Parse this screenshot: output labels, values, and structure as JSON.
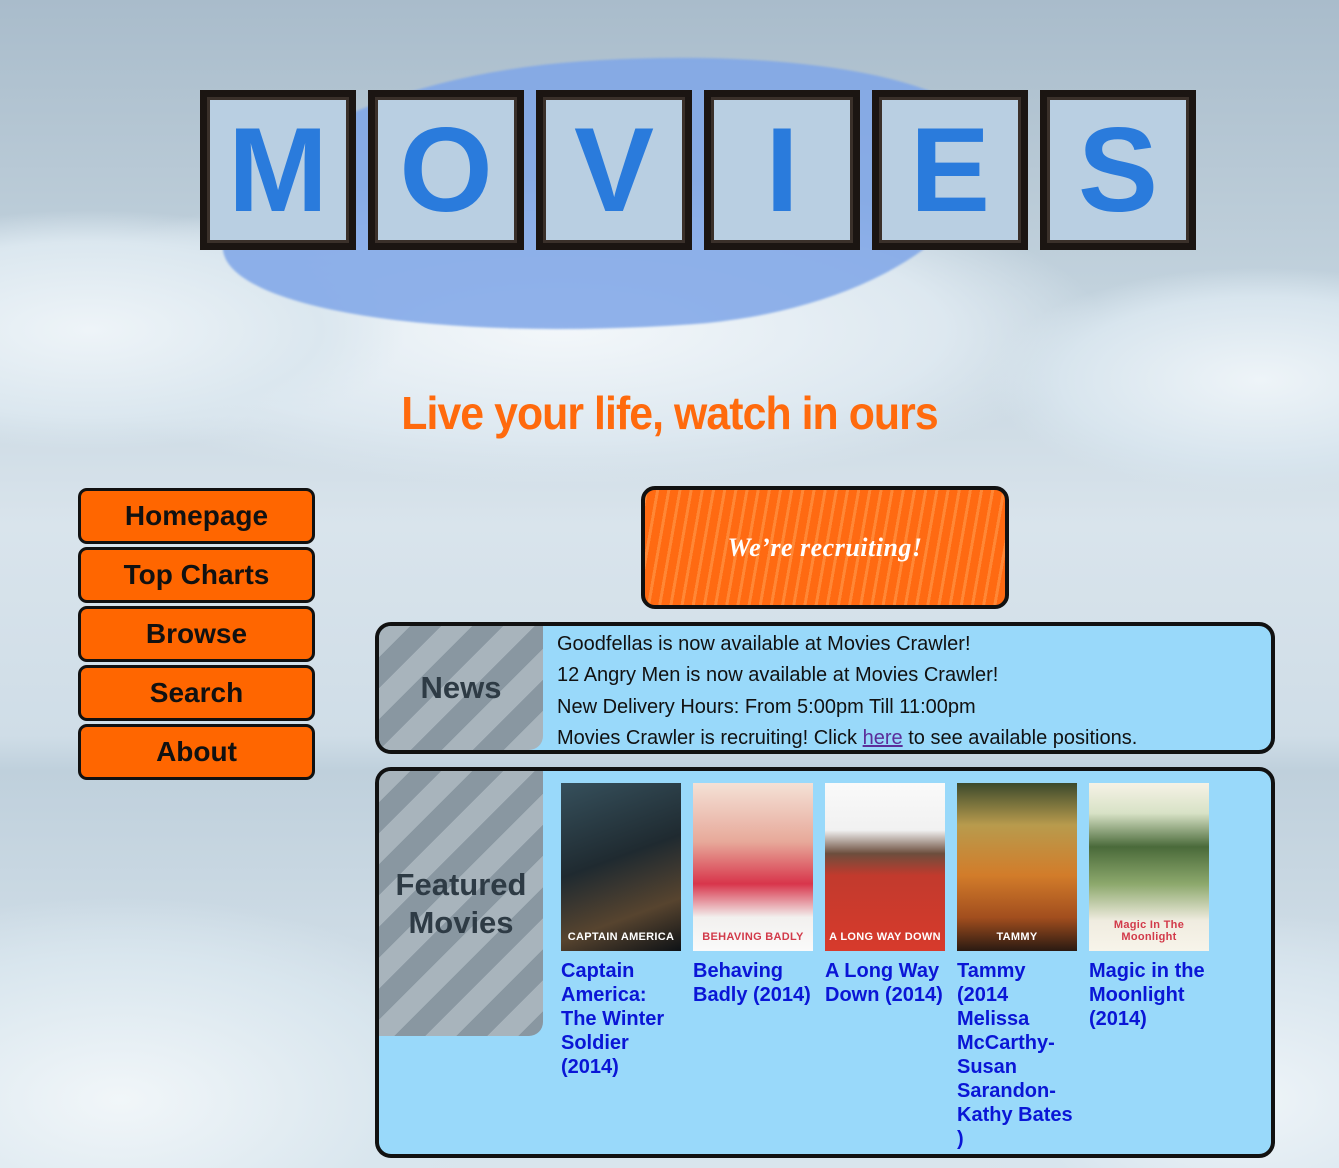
{
  "logo": {
    "letters": [
      "M",
      "O",
      "V",
      "I",
      "E",
      "S"
    ]
  },
  "tagline": "Live your life, watch in ours",
  "nav": [
    {
      "label": "Homepage"
    },
    {
      "label": "Top Charts"
    },
    {
      "label": "Browse"
    },
    {
      "label": "Search"
    },
    {
      "label": "About"
    }
  ],
  "recruit_banner": "We’re recruiting!",
  "news": {
    "heading": "News",
    "items": [
      "Goodfellas is now available at Movies Crawler!",
      "12 Angry Men is now available at Movies Crawler!",
      "New Delivery Hours: From 5:00pm Till 11:00pm"
    ],
    "recruit_item": {
      "before": "Movies Crawler is recruiting! Click ",
      "link": "here",
      "after": " to see available positions."
    }
  },
  "featured": {
    "heading_line1": "Featured",
    "heading_line2": "Movies",
    "movies": [
      {
        "title": "Captain America: The Winter Soldier (2014)",
        "poster_text": "CAPTAIN AMERICA"
      },
      {
        "title": "Behaving Badly (2014)",
        "poster_text": "BEHAVING BADLY"
      },
      {
        "title": "A Long Way Down (2014)",
        "poster_text": "A LONG WAY DOWN"
      },
      {
        "title": "Tammy (2014 Melissa McCarthy-Susan Sarandon-Kathy Bates )",
        "poster_text": "TAMMY"
      },
      {
        "title": "Magic in the Moonlight (2014)",
        "poster_text": "Magic In The Moonlight"
      }
    ]
  },
  "colors": {
    "accent": "#ff6600",
    "panel": "#99d9fa",
    "link": "#0a16d6",
    "tagline": "#ff6a0d"
  }
}
